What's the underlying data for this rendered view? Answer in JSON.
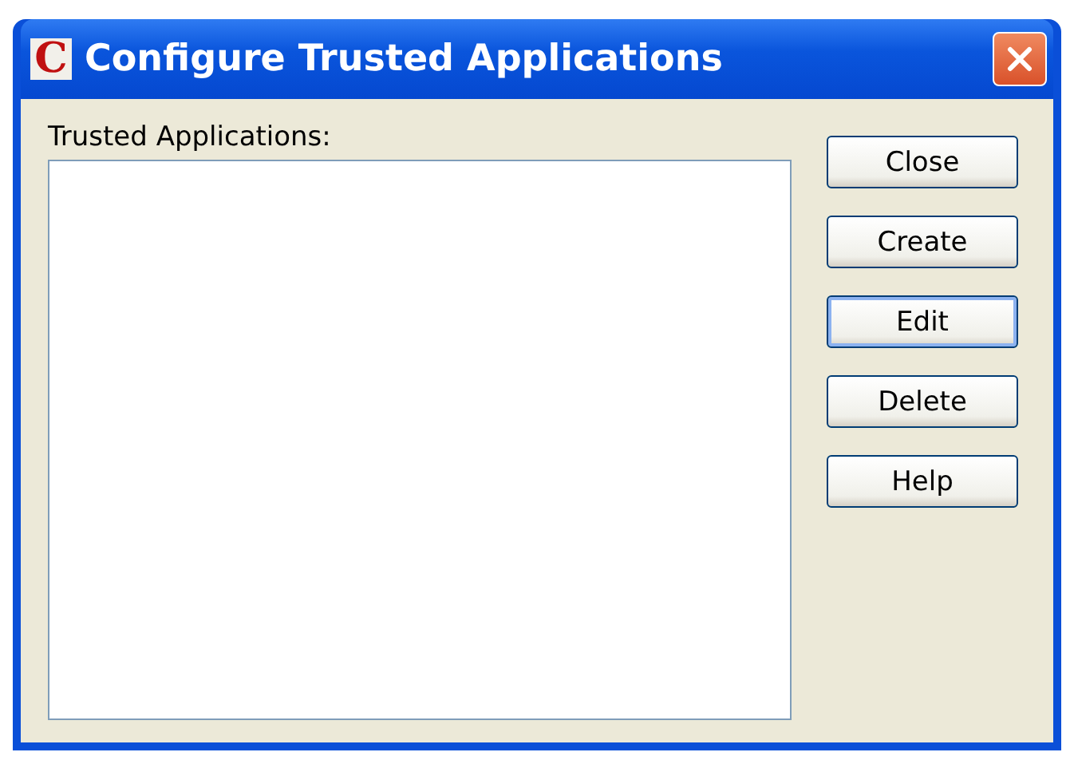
{
  "window": {
    "title": "Configure Trusted Applications",
    "app_icon": "C"
  },
  "list": {
    "label": "Trusted Applications:"
  },
  "buttons": [
    {
      "label": "Close",
      "focused": false
    },
    {
      "label": "Create",
      "focused": false
    },
    {
      "label": "Edit",
      "focused": true
    },
    {
      "label": "Delete",
      "focused": false
    },
    {
      "label": "Help",
      "focused": false
    }
  ]
}
